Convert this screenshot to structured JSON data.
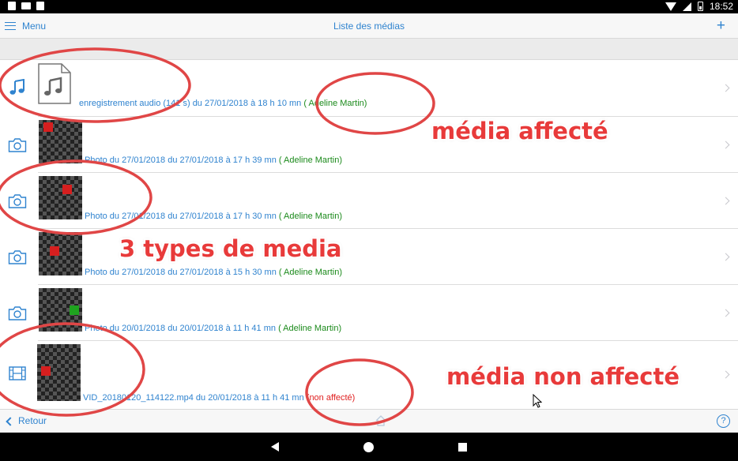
{
  "status_bar": {
    "time": "18:52"
  },
  "header": {
    "menu_label": "Menu",
    "title": "Liste des médias",
    "add_glyph": "+"
  },
  "rows": [
    {
      "type_icon": "music-note-icon",
      "caption": "enregistrement audio (141 s) du 27/01/2018 à 18 h 10 mn",
      "assignee": "( Adeline Martin)"
    },
    {
      "type_icon": "camera-icon",
      "caption": "Photo du 27/01/2018 du 27/01/2018 à 17 h 39 mn",
      "assignee": "( Adeline Martin)",
      "dot_color": "#d61f1f"
    },
    {
      "type_icon": "camera-icon",
      "caption": "Photo du 27/01/2018 du 27/01/2018 à 17 h 30 mn",
      "assignee": "( Adeline Martin)",
      "dot_color": "#d61f1f"
    },
    {
      "type_icon": "camera-icon",
      "caption": "Photo du 27/01/2018 du 27/01/2018 à 15 h 30 mn",
      "assignee": "( Adeline Martin)",
      "dot_color": "#d61f1f"
    },
    {
      "type_icon": "camera-icon",
      "caption": "Photo du 20/01/2018 du 20/01/2018 à 11 h 41 mn",
      "assignee": "( Adeline Martin)",
      "dot_color": "#1fa31f"
    },
    {
      "type_icon": "film-icon",
      "caption": "VID_20180120_114122.mp4 du 20/01/2018 à 11 h 41 mn",
      "assignee": "(non affecté)",
      "dot_color": "#d61f1f"
    }
  ],
  "bottom_bar": {
    "back_label": "Retour",
    "help_glyph": "?"
  },
  "annotations": {
    "assigned": "média affecté",
    "types": "3 types de media",
    "unassigned": "média non affecté"
  },
  "colors": {
    "accent": "#2f83cf",
    "assigned": "#1b8a1b",
    "unassigned": "#e02020",
    "annotation": "#e83a3a"
  }
}
